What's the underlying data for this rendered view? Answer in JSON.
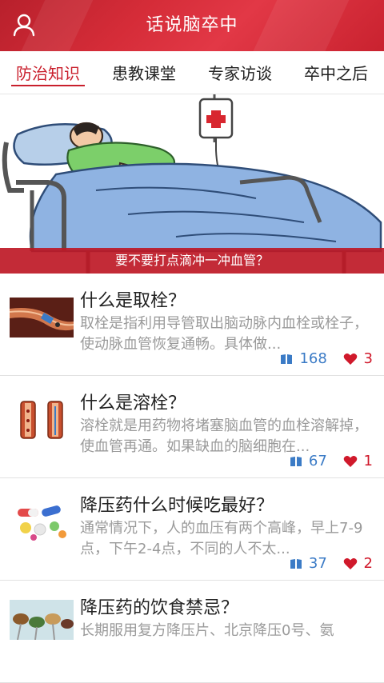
{
  "header": {
    "title": "话说脑卒中",
    "user_icon": "user-icon",
    "color": "#d02a36"
  },
  "tabs": [
    {
      "label": "防治知识",
      "active": true
    },
    {
      "label": "患教课堂",
      "active": false
    },
    {
      "label": "专家访谈",
      "active": false
    },
    {
      "label": "卒中之后",
      "active": false
    }
  ],
  "banner": {
    "caption": "要不要打点滴冲一冲血管？"
  },
  "articles": [
    {
      "title": "什么是取栓？",
      "summary": "取栓是指利用导管取出脑动脉内血栓或栓子，使动脉血管恢复通畅。具体做...",
      "reads": "168",
      "likes": "3",
      "thumb": "vessel-thrombectomy-image"
    },
    {
      "title": "什么是溶栓？",
      "summary": "溶栓就是用药物将堵塞脑血管的血栓溶解掉，使血管再通。如果缺血的脑细胞在...",
      "reads": "67",
      "likes": "1",
      "thumb": "vessel-thrombolysis-image"
    },
    {
      "title": "降压药什么时候吃最好？",
      "summary": "通常情况下，人的血压有两个高峰，早上7-9点，下午2-4点，不同的人不太...",
      "reads": "37",
      "likes": "2",
      "thumb": "pills-image"
    },
    {
      "title": "降压药的饮食禁忌？",
      "summary": "长期服用复方降压片、北京降压0号、氨",
      "reads": "",
      "likes": "",
      "thumb": "food-spoons-image"
    }
  ],
  "colors": {
    "accent": "#c91f2c",
    "read": "#3b7bc6",
    "like": "#d0192b"
  }
}
